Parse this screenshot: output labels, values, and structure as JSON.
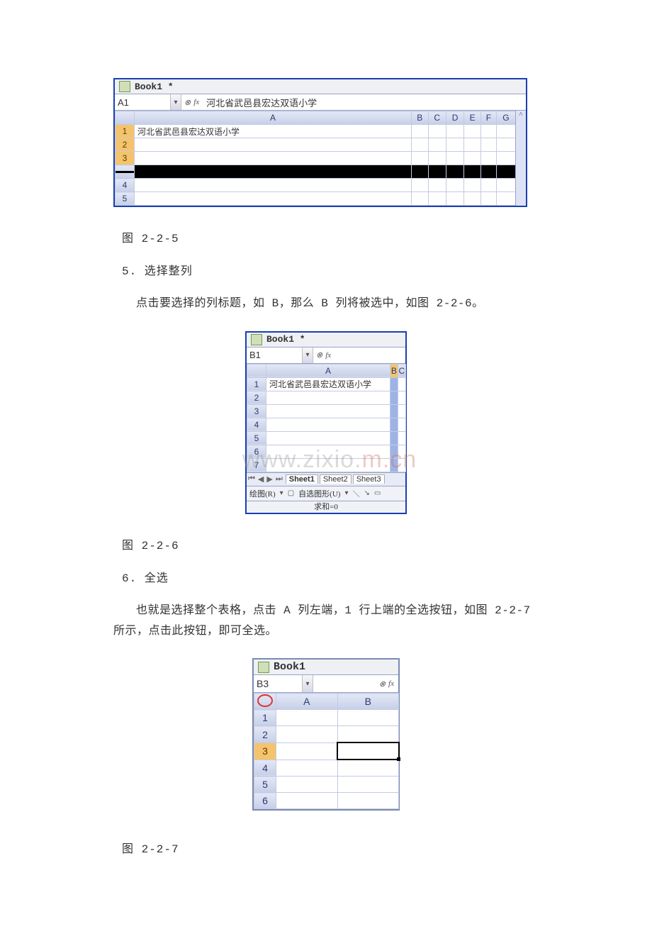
{
  "captions": {
    "fig5": "图 2-2-5",
    "fig6": "图 2-2-6",
    "fig7": "图 2-2-7"
  },
  "sections": {
    "s5_title": "5. 选择整列",
    "s5_para": "点击要选择的列标题，如 B，那么 B 列将被选中，如图 2-2-6。",
    "s6_title": "6. 全选",
    "s6_para": "也就是选择整个表格，点击 A 列左端，1 行上端的全选按钮，如图 2-2-7 所示，点击此按钮，即可全选。"
  },
  "watermark_left": "www",
  "watermark_mid": "zixi",
  "watermark_right": "m.cn",
  "fig5": {
    "book_title": "Book1 *",
    "namebox": "A1",
    "fx_label": "fx",
    "fx_content": "河北省武邑县宏达双语小学",
    "cols": [
      "A",
      "B",
      "C",
      "D",
      "E",
      "F",
      "G"
    ],
    "rows": [
      "1",
      "2",
      "3",
      "4",
      "5"
    ],
    "a1_value": "河北省武邑县宏达双语小学"
  },
  "fig6": {
    "book_title": "Book1 *",
    "namebox": "B1",
    "fx_label": "fx",
    "cols": [
      "A",
      "B",
      "C"
    ],
    "rows": [
      "1",
      "2",
      "3",
      "4",
      "5",
      "6",
      "7"
    ],
    "a1_value": "河北省武邑县宏达双语小学",
    "sheet_tabs": [
      "Sheet1",
      "Sheet2",
      "Sheet3"
    ],
    "draw_label": "绘图(R)",
    "autoshape_label": "自选图形(U)",
    "status": "求和=0"
  },
  "fig7": {
    "book_title": "Book1",
    "namebox": "B3",
    "fx_label": "fx",
    "cols": [
      "A",
      "B"
    ],
    "rows": [
      "1",
      "2",
      "3",
      "4",
      "5",
      "6"
    ]
  }
}
